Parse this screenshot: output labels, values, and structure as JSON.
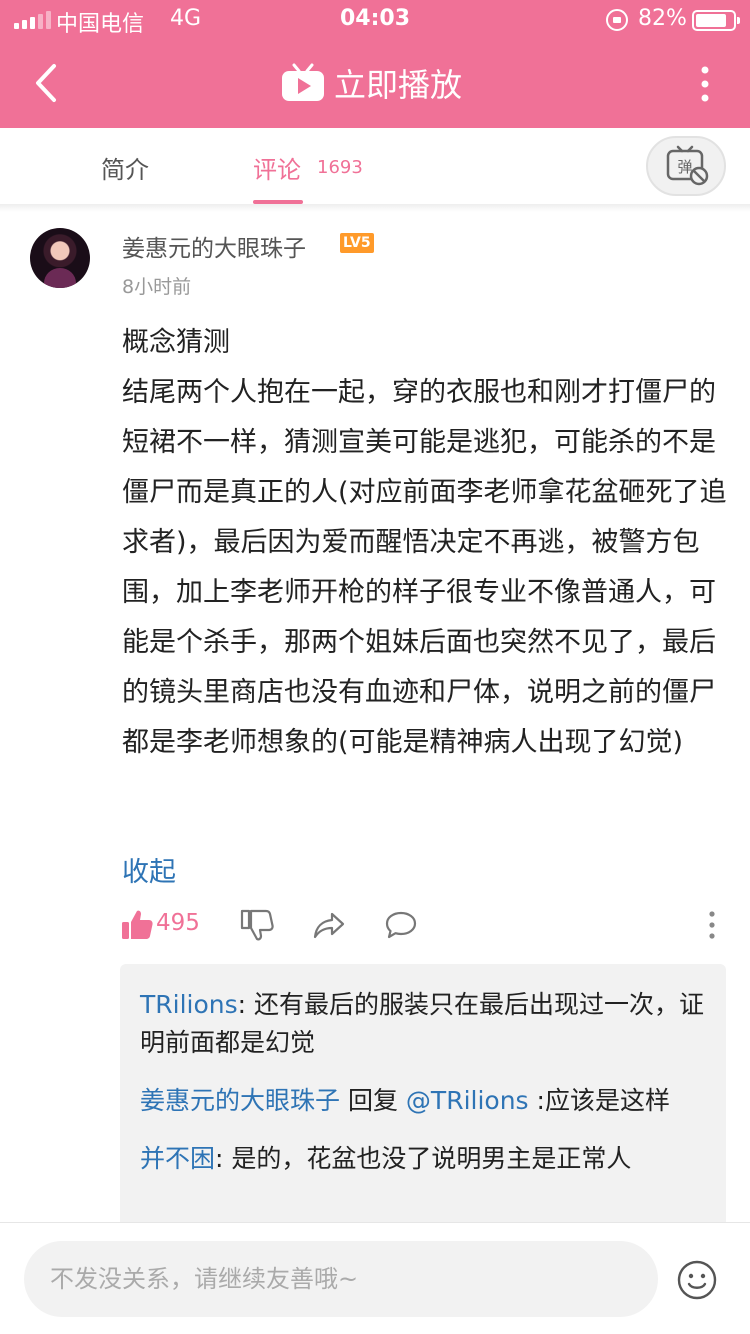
{
  "status_bar": {
    "carrier": "中国电信",
    "network": "4G",
    "time": "04:03",
    "battery": "82%",
    "battery_level": 0.82
  },
  "nav": {
    "title": "立即播放"
  },
  "tabs": {
    "intro": "简介",
    "comments": "评论",
    "comment_count": "1693"
  },
  "comment": {
    "username": "姜惠元的大眼珠子",
    "level": "LV5",
    "time": "8小时前",
    "paragraphs": [
      "概念猜测",
      "结尾两个人抱在一起，穿的衣服也和刚才打僵尸的短裙不一样，猜测宣美可能是逃犯，可能杀的不是僵尸而是真正的人(对应前面李老师拿花盆砸死了追求者)，最后因为爱而醒悟决定不再逃，被警方包围，加上李老师开枪的样子很专业不像普通人，可能是个杀手，那两个姐妹后面也突然不见了，最后的镜头里商店也没有血迹和尸体，说明之前的僵尸都是李老师想象的(可能是精神病人出现了幻觉)"
    ],
    "collapse_label": "收起",
    "like_count": "495"
  },
  "replies": [
    {
      "name": "TRilions",
      "text": ": 还有最后的服装只在最后出现过一次，证明前面都是幻觉"
    },
    {
      "name": "姜惠元的大眼珠子",
      "reply_word": " 回复 ",
      "mention": "@TRilions",
      "text": " :应该是这样"
    },
    {
      "name": "并不困",
      "text": ": 是的，花盆也没了说明男主是正常人"
    }
  ],
  "input": {
    "placeholder": "不发没关系，请继续友善哦~"
  },
  "colors": {
    "brand_pink": "#f07197",
    "link_blue": "#2e74b5",
    "level_orange": "#ff9a2a"
  },
  "icons": [
    "back-arrow-icon",
    "tv-icon",
    "more-vertical-icon",
    "danmaku-off-icon",
    "thumbs-up-icon",
    "thumbs-down-icon",
    "share-icon",
    "comment-bubble-icon",
    "more-vertical-icon",
    "emoji-icon"
  ]
}
